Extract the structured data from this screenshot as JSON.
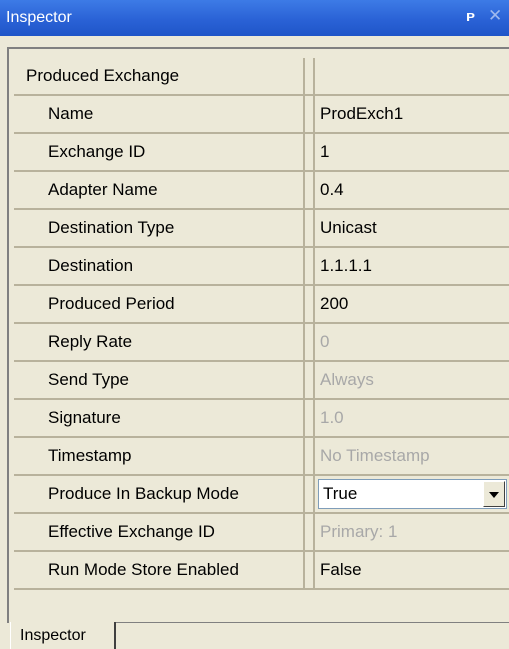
{
  "window": {
    "title": "Inspector",
    "pin_glyph": "ᵖ",
    "close_glyph": "×"
  },
  "properties": {
    "section": {
      "label": "Produced Exchange",
      "value": ""
    },
    "rows": [
      {
        "label": "Name",
        "value": "ProdExch1",
        "readonly": false
      },
      {
        "label": "Exchange ID",
        "value": "1",
        "readonly": false
      },
      {
        "label": "Adapter Name",
        "value": "0.4",
        "readonly": false
      },
      {
        "label": "Destination Type",
        "value": "Unicast",
        "readonly": false
      },
      {
        "label": "Destination",
        "value": "1.1.1.1",
        "readonly": false
      },
      {
        "label": "Produced Period",
        "value": "200",
        "readonly": false
      },
      {
        "label": "Reply Rate",
        "value": "0",
        "readonly": true
      },
      {
        "label": "Send Type",
        "value": "Always",
        "readonly": true
      },
      {
        "label": "Signature",
        "value": "1.0",
        "readonly": true
      },
      {
        "label": "Timestamp",
        "value": "No Timestamp",
        "readonly": true
      },
      {
        "label": "Produce In Backup Mode",
        "value": "True",
        "readonly": false
      },
      {
        "label": "Effective Exchange ID",
        "value": "Primary: 1",
        "readonly": true
      },
      {
        "label": "Run Mode Store Enabled",
        "value": "False",
        "readonly": false
      }
    ]
  },
  "bottom_tabs": [
    {
      "label": "Inspector"
    }
  ],
  "colors": {
    "title_bar": "#2a62d6",
    "panel_bg": "#ece9d8",
    "grid_line": "#b8b29c",
    "readonly_text": "#a8a8a8"
  }
}
